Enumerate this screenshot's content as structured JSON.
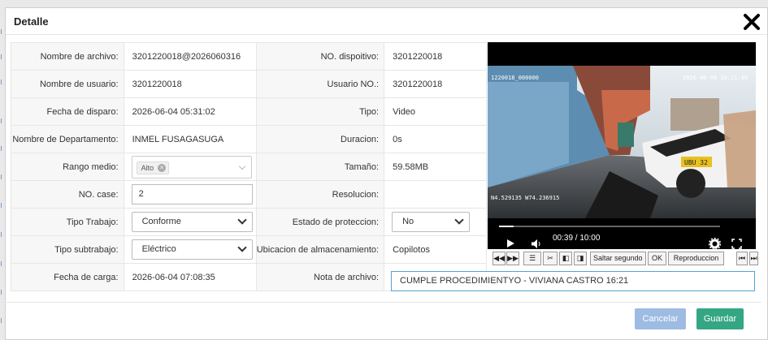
{
  "dialog": {
    "title": "Detalle"
  },
  "fields": {
    "file_name_label": "Nombre de archivo:",
    "file_name_value": "3201220018@2026060316",
    "device_no_label": "NO. dispoitivo:",
    "device_no_value": "3201220018",
    "user_name_label": "Nombre de usuario:",
    "user_name_value": "3201220018",
    "user_no_label": "Usuario NO.:",
    "user_no_value": "3201220018",
    "trigger_date_label": "Fecha de disparo:",
    "trigger_date_value": "2026-06-04 05:31:02",
    "type_label": "Tipo:",
    "type_value": "Video",
    "department_label": "Nombre de Departamento:",
    "department_value": "INMEL FUSAGASUGA",
    "duration_label": "Duracion:",
    "duration_value": "0s",
    "range_label": "Rango medio:",
    "range_tag": "Alto",
    "size_label": "Tamaño:",
    "size_value": "59.58MB",
    "case_label": "NO. case:",
    "case_value": "2",
    "resolution_label": "Resolucion:",
    "resolution_value": "",
    "work_type_label": "Tipo Trabajo:",
    "work_type_value": "Conforme",
    "protection_label": "Estado de proteccion:",
    "protection_value": "No",
    "subwork_label": "Tipo subtrabajo:",
    "subwork_value": "Eléctrico",
    "storage_label": "Ubicacion de almacenamiento:",
    "storage_value": "Copilotos",
    "upload_date_label": "Fecha de carga:",
    "upload_date_value": "2026-06-04 07:08:35",
    "note_label": "Nota de archivo:",
    "note_value": "CUMPLE PROCEDIMIENTYO - VIVIANA CASTRO 16:21"
  },
  "video": {
    "osd_id": "1220018_000000",
    "osd_datetime": "2026-06-08  16:21:40",
    "osd_gps": "N4.529135  W74.236915",
    "plate": "UBU 32",
    "time": "00:39 / 10:00",
    "progress": 0.065
  },
  "toolbar": {
    "skip_placeholder": "Saltar segundo",
    "ok_label": "OK",
    "playback_label": "Reproduccion"
  },
  "buttons": {
    "cancel": "Cancelar",
    "save": "Guardar"
  },
  "colors": {
    "save": "#34a683",
    "cancel": "#9dbbe3",
    "focus": "#5aa0d0"
  }
}
